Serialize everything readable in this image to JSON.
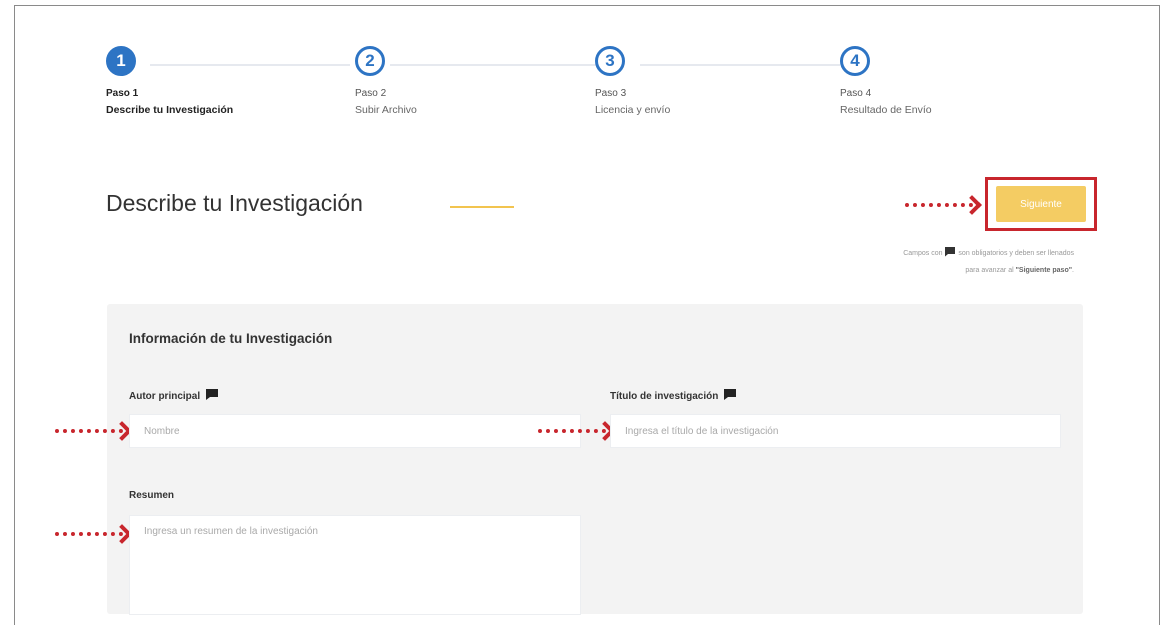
{
  "stepper": {
    "steps": [
      {
        "number": "1",
        "label": "Paso 1",
        "name": "Describe tu Investigación",
        "active": true
      },
      {
        "number": "2",
        "label": "Paso 2",
        "name": "Subir Archivo",
        "active": false
      },
      {
        "number": "3",
        "label": "Paso 3",
        "name": "Licencia y envío",
        "active": false
      },
      {
        "number": "4",
        "label": "Paso 4",
        "name": "Resultado de Envío",
        "active": false
      }
    ]
  },
  "header": {
    "title": "Describe tu Investigación",
    "next_label": "Siguiente"
  },
  "required_note": {
    "before_icon": "Campos con",
    "after_icon": "son obligatorios y deben ser llenados",
    "line2_prefix": "para avanzar al",
    "line2_bold": "\"Siguiente paso\"",
    "line2_suffix": "."
  },
  "form": {
    "section_title": "Información de tu Investigación",
    "author": {
      "label": "Autor principal",
      "placeholder": "Nombre"
    },
    "title_field": {
      "label": "Título de investigación",
      "placeholder": "Ingresa el título de la investigación"
    },
    "summary": {
      "label": "Resumen",
      "placeholder": "Ingresa un resumen de la investigación"
    }
  },
  "colors": {
    "primary": "#2d74c4",
    "accent": "#f4cc63",
    "highlight": "#c8262d"
  },
  "icons": {
    "required": "comment-icon",
    "hint": "dotted-arrow-icon"
  }
}
